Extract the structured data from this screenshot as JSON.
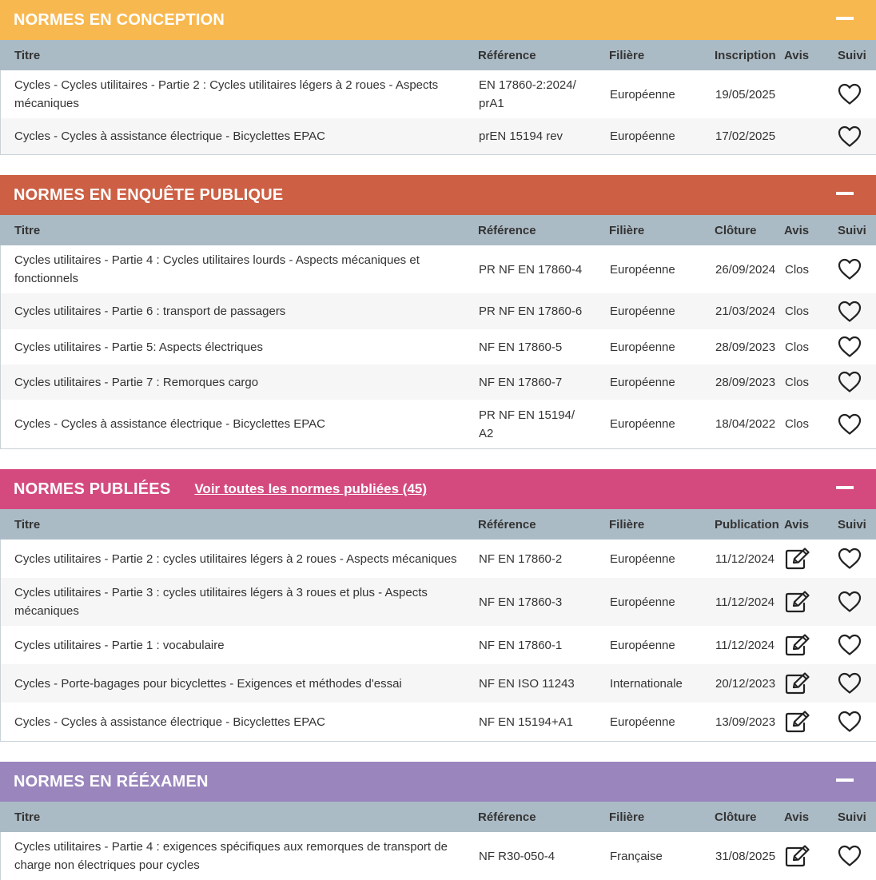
{
  "colors": {
    "conception": "#f8b850",
    "enquete": "#cc5f44",
    "publiees": "#d44a7f",
    "reexamen": "#9a86bd",
    "table_header": "#abbbc5"
  },
  "icons": {
    "collapse": "minus-icon",
    "follow": "heart-icon",
    "review": "edit-icon"
  },
  "columns": {
    "titre": "Titre",
    "reference": "Référence",
    "filiere": "Filière",
    "avis": "Avis",
    "suivi": "Suivi"
  },
  "conception": {
    "title": "NORMES EN CONCEPTION",
    "date_label": "Inscription",
    "rows": [
      {
        "titre": "Cycles - Cycles utilitaires - Partie 2 : Cycles utilitaires légers à 2 roues - Aspects mécaniques",
        "reference": "EN 17860-2:2024/ prA1",
        "filiere": "Européenne",
        "date": "19/05/2025",
        "avis": ""
      },
      {
        "titre": "Cycles - Cycles à assistance électrique - Bicyclettes EPAC",
        "reference": "prEN 15194 rev",
        "filiere": "Européenne",
        "date": "17/02/2025",
        "avis": ""
      }
    ]
  },
  "enquete": {
    "title": "NORMES EN ENQUÊTE PUBLIQUE",
    "date_label": "Clôture",
    "rows": [
      {
        "titre": "Cycles utilitaires - Partie 4 : Cycles utilitaires lourds - Aspects mécaniques et fonctionnels",
        "reference": "PR NF EN 17860-4",
        "filiere": "Européenne",
        "date": "26/09/2024",
        "avis": "Clos"
      },
      {
        "titre": "Cycles utilitaires - Partie 6 : transport de passagers",
        "reference": "PR NF EN 17860-6",
        "filiere": "Européenne",
        "date": "21/03/2024",
        "avis": "Clos"
      },
      {
        "titre": "Cycles utilitaires - Partie 5: Aspects électriques",
        "reference": "NF EN 17860-5",
        "filiere": "Européenne",
        "date": "28/09/2023",
        "avis": "Clos"
      },
      {
        "titre": "Cycles utilitaires - Partie 7 : Remorques cargo",
        "reference": "NF EN 17860-7",
        "filiere": "Européenne",
        "date": "28/09/2023",
        "avis": "Clos"
      },
      {
        "titre": "Cycles - Cycles à assistance électrique - Bicyclettes EPAC",
        "reference": "PR NF EN 15194/ A2",
        "filiere": "Européenne",
        "date": "18/04/2022",
        "avis": "Clos"
      }
    ]
  },
  "publiees": {
    "title": "NORMES PUBLIÉES",
    "link": "Voir toutes les normes publiées (45)",
    "date_label": "Publication",
    "rows": [
      {
        "titre": "Cycles utilitaires - Partie 2 : cycles utilitaires légers à 2 roues - Aspects mécaniques",
        "reference": "NF EN 17860-2",
        "filiere": "Européenne",
        "date": "11/12/2024"
      },
      {
        "titre": "Cycles utilitaires - Partie 3 : cycles utilitaires légers à 3 roues et plus - Aspects mécaniques",
        "reference": "NF EN 17860-3",
        "filiere": "Européenne",
        "date": "11/12/2024"
      },
      {
        "titre": "Cycles utilitaires - Partie 1 : vocabulaire",
        "reference": "NF EN 17860-1",
        "filiere": "Européenne",
        "date": "11/12/2024"
      },
      {
        "titre": "Cycles - Porte-bagages pour bicyclettes - Exigences et méthodes d'essai",
        "reference": "NF EN ISO 11243",
        "filiere": "Internationale",
        "date": "20/12/2023"
      },
      {
        "titre": "Cycles - Cycles à assistance électrique - Bicyclettes EPAC",
        "reference": "NF EN 15194+A1",
        "filiere": "Européenne",
        "date": "13/09/2023"
      }
    ]
  },
  "reexamen": {
    "title": "NORMES EN RÉÉXAMEN",
    "date_label": "Clôture",
    "rows": [
      {
        "titre": "Cycles utilitaires - Partie 4 : exigences spécifiques aux remorques de transport de charge non électriques pour cycles",
        "reference": "NF R30-050-4",
        "filiere": "Française",
        "date": "31/08/2025"
      }
    ]
  }
}
